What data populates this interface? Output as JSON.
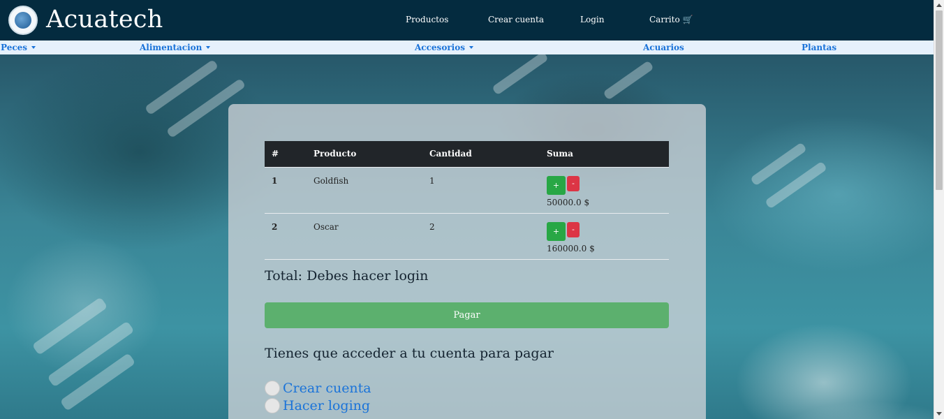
{
  "header": {
    "brand": "Acuatech",
    "nav": [
      "Productos",
      "Crear cuenta",
      "Login",
      "Carrito 🛒"
    ]
  },
  "categories": [
    {
      "label": "Peces",
      "dropdown": true
    },
    {
      "label": "Alimentacion",
      "dropdown": true
    },
    {
      "label": "Accesorios",
      "dropdown": true
    },
    {
      "label": "Acuarios",
      "dropdown": false
    },
    {
      "label": "Plantas",
      "dropdown": false
    }
  ],
  "cart": {
    "columns": [
      "#",
      "Producto",
      "Cantidad",
      "Suma"
    ],
    "rows": [
      {
        "num": "1",
        "product": "Goldfish",
        "qty": "1",
        "sum": "50000.0 $"
      },
      {
        "num": "2",
        "product": "Oscar",
        "qty": "2",
        "sum": "160000.0 $"
      }
    ],
    "plus_label": "+",
    "minus_label": "-",
    "total": "Total: Debes hacer login",
    "pay_label": "Pagar",
    "login_message": "Tienes que acceder a tu cuenta para pagar",
    "options": [
      "Crear cuenta",
      "Hacer loging"
    ]
  },
  "colors": {
    "header_bg": "#042b3f",
    "category_bar_bg": "#e6f1fc",
    "link": "#1a73d9",
    "plus": "#28a745",
    "minus": "#dc3545",
    "pay": "#5cb06e"
  }
}
